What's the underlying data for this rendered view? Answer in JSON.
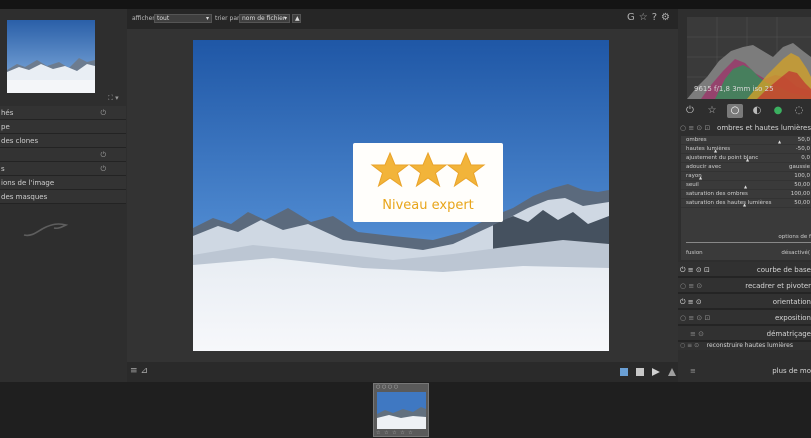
{
  "topbar": {
    "afficher_label": "afficher",
    "afficher_value": "tout",
    "trier_label": "trier par",
    "trier_value": "nom de fichier",
    "sort_dir": "▲",
    "dropdown_arrow": "▾",
    "icons": [
      "G",
      "☆",
      "?",
      "⚙"
    ]
  },
  "left_panel": {
    "expand_icon": "⛶ ▾",
    "items": [
      {
        "label": "hés",
        "power": "⏻"
      },
      {
        "label": "pe",
        "power": ""
      },
      {
        "label": "des clones",
        "power": ""
      },
      {
        "label": "",
        "power": "⏻"
      },
      {
        "label": "s",
        "power": "⏻"
      },
      {
        "label": "ions de l'image",
        "power": ""
      },
      {
        "label": "des masques",
        "power": ""
      }
    ]
  },
  "badge": {
    "stars": 3,
    "text": "Niveau expert",
    "color": "#f2b43a"
  },
  "bottombar": {
    "left_icons": [
      "≡",
      "⊿"
    ],
    "right_colors": [
      "#6a9fd4",
      "#c8c8c8",
      "#d0d0d0",
      "#a0a0a0"
    ]
  },
  "right_panel": {
    "histogram_info": "9615 f/1,8 3mm iso 25",
    "tabs": [
      "⏻",
      "☆",
      "○",
      "◐",
      "●",
      "◌"
    ],
    "active_tab_index": 2,
    "module_header": {
      "controls": "○ ≡ ⊙ ⊡",
      "title": "ombres et hautes lumières"
    },
    "params": [
      {
        "label": "ombres",
        "value": "50,0"
      },
      {
        "label": "hautes lumières",
        "value": "-50,0"
      },
      {
        "label": "ajustement du point blanc",
        "value": "0,0"
      },
      {
        "label": "adoucir avec",
        "value": "gaussie"
      },
      {
        "label": "rayon",
        "value": "100,0"
      },
      {
        "label": "seuil",
        "value": "50,00"
      },
      {
        "label": "saturation des ombres",
        "value": "100,00"
      },
      {
        "label": "saturation des hautes lumières",
        "value": "50,00"
      }
    ],
    "options_label": "options de f",
    "fusion_label": "fusion",
    "fusion_value": "désactivé(",
    "modules": [
      {
        "controls": "⏻ ≡ ⊙ ⊡",
        "title": "courbe de base",
        "on": true
      },
      {
        "controls": "○ ≡ ⊙",
        "title": "recadrer et pivoter",
        "on": false
      },
      {
        "controls": "⏻ ≡ ⊙",
        "title": "orientation",
        "on": true
      },
      {
        "controls": "○ ≡ ⊙ ⊡",
        "title": "exposition",
        "on": false
      },
      {
        "controls": "≡ ⊙",
        "title": "dématriçage",
        "on": false
      },
      {
        "controls": "○ ≡ ⊙",
        "title": "reconstruire hautes lumières",
        "on": false
      }
    ],
    "more_controls": "≡",
    "more_label": "plus de mo"
  },
  "filmstrip": {
    "thumb_top": "○ ○ ○ ○",
    "thumb_bottom": "☆ ☆ ☆ ☆ ☆"
  }
}
